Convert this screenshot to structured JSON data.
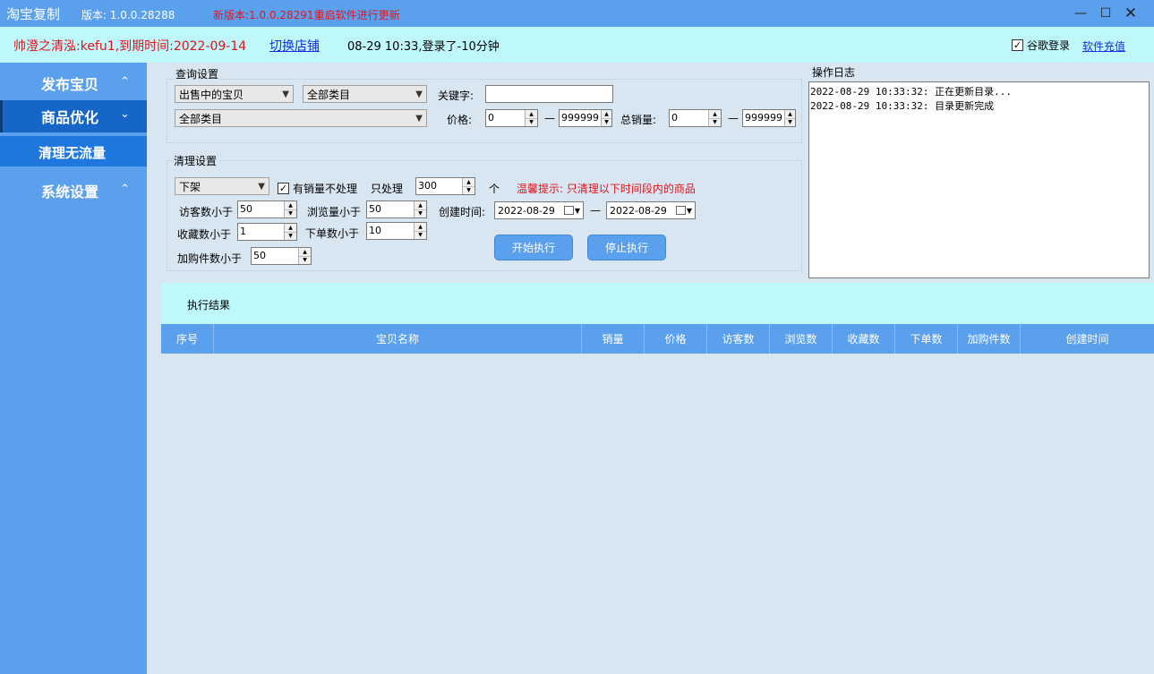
{
  "titlebar": {
    "app_title": "淘宝复制",
    "version": "版本: 1.0.0.28288",
    "update_notice": "新版本:1.0.0.28291重启软件进行更新"
  },
  "infobar": {
    "user_info": "帅澄之清泓:kefu1,到期时间:2022-09-14",
    "switch_shop": "切换店铺",
    "login_info": "08-29 10:33,登录了-10分钟",
    "google_login": "谷歌登录",
    "google_checked": "☑",
    "recharge": "软件充值"
  },
  "sidebar": {
    "items": [
      {
        "label": "发布宝贝",
        "chevron": "⌃"
      },
      {
        "label": "商品优化",
        "chevron": "⌄"
      },
      {
        "label": "清理无流量"
      },
      {
        "label": "系统设置",
        "chevron": "⌃"
      }
    ]
  },
  "query": {
    "title": "查询设置",
    "status_select": "出售中的宝贝",
    "category_select1": "全部类目",
    "category_select2": "全部类目",
    "keyword_label": "关键字:",
    "keyword_value": "",
    "price_label": "价格:",
    "price_min": "0",
    "price_max": "999999",
    "sales_label": "总销量:",
    "sales_min": "0",
    "sales_max": "999999",
    "dash": "—"
  },
  "clean": {
    "title": "清理设置",
    "action_select": "下架",
    "skip_sold_label": "有销量不处理",
    "only_label": "只处理",
    "only_value": "300",
    "unit": "个",
    "tip": "温馨提示: 只清理以下时间段内的商品",
    "visitor_label": "访客数小于",
    "visitor_value": "50",
    "views_label": "浏览量小于",
    "views_value": "50",
    "created_label": "创建时间:",
    "date_from": "2022-08-29",
    "date_to": "2022-08-29",
    "fav_label": "收藏数小于",
    "fav_value": "1",
    "orders_label": "下单数小于",
    "orders_value": "10",
    "cart_label": "加购件数小于",
    "cart_value": "50",
    "start_button": "开始执行",
    "stop_button": "停止执行"
  },
  "log": {
    "title": "操作日志",
    "lines": [
      "2022-08-29 10:33:32: 正在更新目录...",
      "2022-08-29 10:33:32: 目录更新完成"
    ]
  },
  "result": {
    "title": "执行结果",
    "columns": [
      "序号",
      "宝贝名称",
      "销量",
      "价格",
      "访客数",
      "浏览数",
      "收藏数",
      "下单数",
      "加购件数",
      "创建时间"
    ]
  },
  "icons": {
    "minimize": "—",
    "maximize": "☐",
    "close": "✕",
    "spin_up": "▲",
    "spin_down": "▼",
    "dropdown": "▼"
  }
}
